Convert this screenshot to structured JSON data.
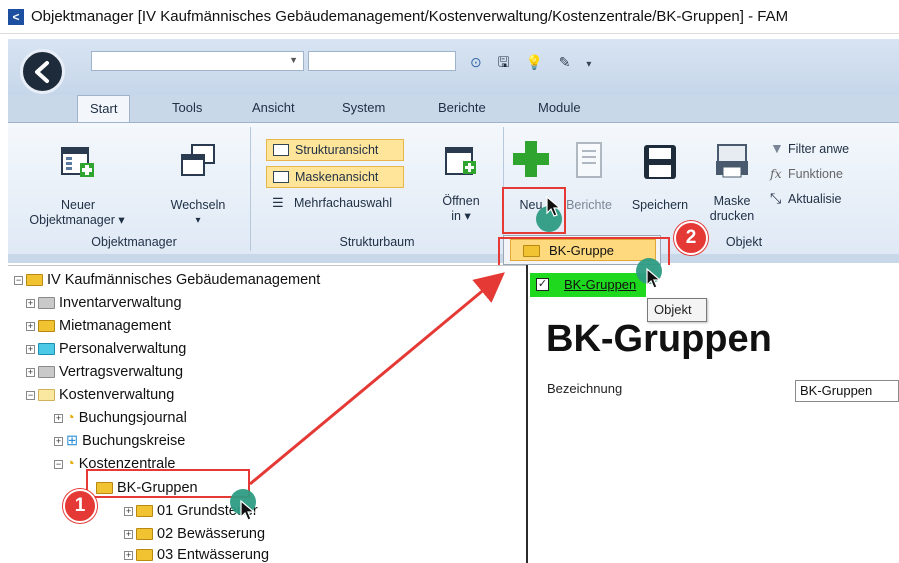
{
  "window": {
    "app_icon": "<",
    "title": "Objektmanager [IV Kaufmännisches Gebäudemanagement/Kostenverwaltung/Kostenzentrale/BK-Gruppen] - FAM"
  },
  "tabs": [
    "Start",
    "Tools",
    "Ansicht",
    "System",
    "Berichte",
    "Module"
  ],
  "ribbon": {
    "objektmanager": {
      "label": "Objektmanager",
      "neuer_line1": "Neuer",
      "neuer_line2": "Objektmanager ▾",
      "wechseln": "Wechseln",
      "wechseln_arrow": "▾"
    },
    "strukturbaum": {
      "label": "Strukturbaum",
      "strukturansicht": "Strukturansicht",
      "maskenansicht": "Maskenansicht",
      "mehrfachauswahl": "Mehrfachauswahl",
      "oeffnen_line1": "Öffnen",
      "oeffnen_line2": "in ▾"
    },
    "objekt": {
      "label": "Objekt",
      "neu": "Neu",
      "berichte": "Berichte",
      "speichern": "Speichern",
      "maske_line1": "Maske",
      "maske_line2": "drucken",
      "filter": "Filter anwe",
      "funktionen": "Funktione",
      "aktualisieren": "Aktualisie"
    }
  },
  "dropdown": {
    "item": "BK-Gruppe"
  },
  "tree": {
    "items": [
      "IV Kaufmännisches Gebäudemanagement",
      "Inventarverwaltung",
      "Mietmanagement",
      "Personalverwaltung",
      "Vertragsverwaltung",
      "Kostenverwaltung",
      "Buchungsjournal",
      "Buchungskreise",
      "Kostenzentrale",
      "BK-Gruppen",
      "01 Grundsteuer",
      "02 Bewässerung",
      "03 Entwässerung"
    ]
  },
  "detail": {
    "tab_label": "BK-Gruppen",
    "tooltip": "Objekt",
    "heading": "BK-Gruppen",
    "field_label": "Bezeichnung",
    "field_value": "BK-Gruppen"
  },
  "annotations": {
    "step1": "1",
    "step2": "2"
  },
  "colors": {
    "annotation_red": "#e53935",
    "cursor_teal": "#2e9b83",
    "tab_green": "#1ed91e",
    "highlight": "#ffe59a"
  },
  "icons": [
    "back-arrow-icon",
    "save-icon",
    "lightbulb-icon",
    "edit-icon",
    "plus-icon",
    "report-icon",
    "print-icon",
    "filter-icon",
    "function-icon",
    "refresh-icon",
    "folder-icon"
  ]
}
